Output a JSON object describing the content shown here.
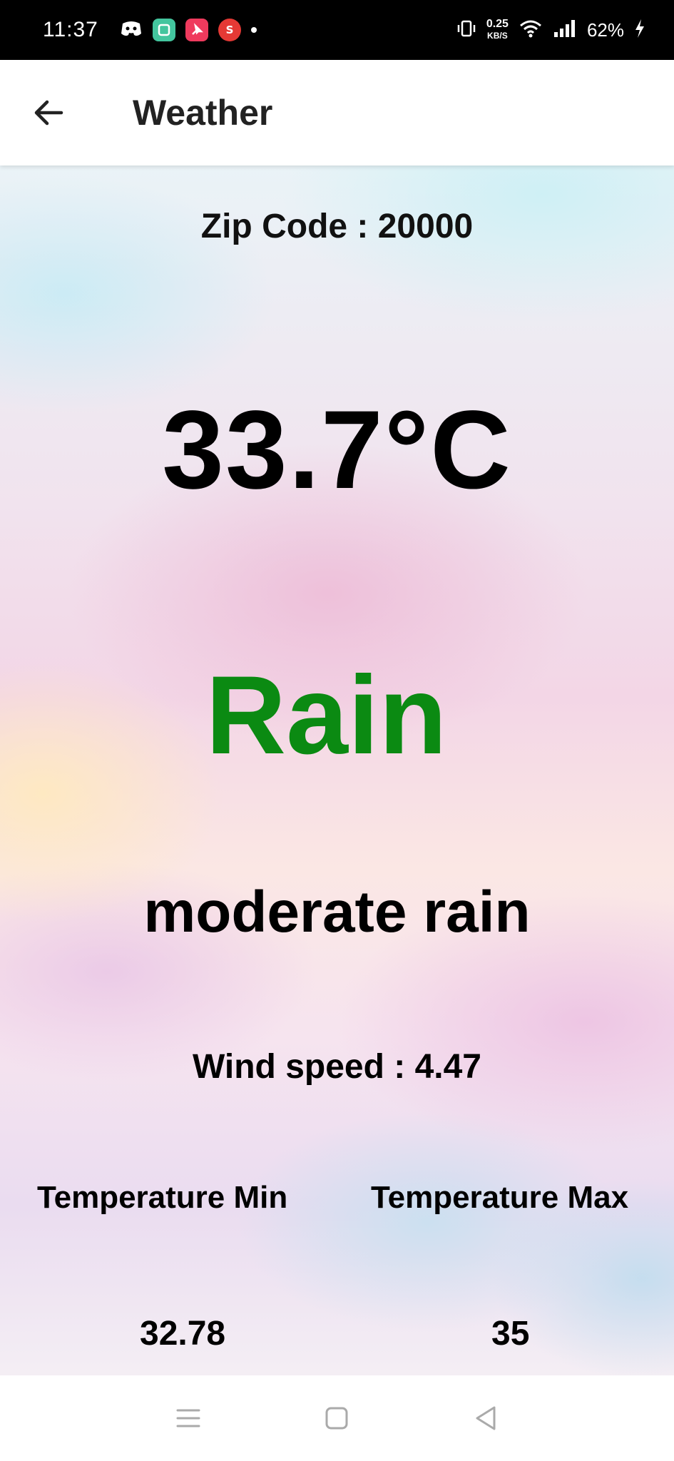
{
  "status_bar": {
    "time": "11:37",
    "net_speed_value": "0.25",
    "net_speed_unit": "KB/S",
    "battery": "62%"
  },
  "app_bar": {
    "title": "Weather"
  },
  "weather": {
    "zip_code": "Zip Code : 20000",
    "temperature": "33.7°C",
    "condition": "Rain",
    "condition_color": "#0b8a12",
    "description": "moderate rain",
    "wind_speed": "Wind speed : 4.47",
    "temp_min_label": "Temperature Min",
    "temp_max_label": "Temperature Max",
    "temp_min_value": "32.78",
    "temp_max_value": "35"
  },
  "icons": {
    "back": "arrow-left-icon",
    "recents": "menu-lines-icon",
    "home": "square-icon",
    "back_nav": "triangle-left-icon"
  }
}
